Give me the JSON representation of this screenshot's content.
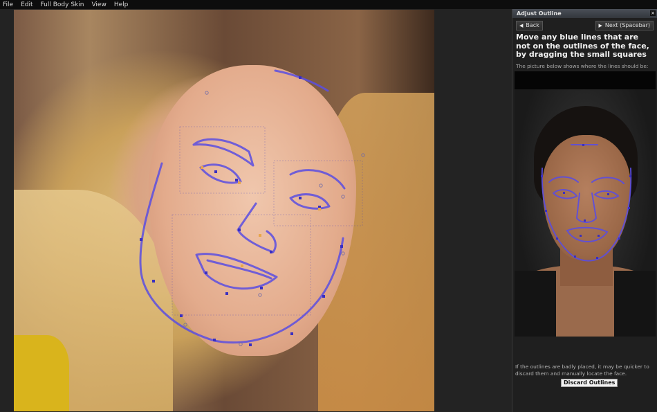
{
  "menu": {
    "items": [
      "File",
      "Edit",
      "Full Body Skin",
      "View",
      "Help"
    ]
  },
  "panel": {
    "title": "Adjust Outline",
    "close_icon": "close-icon",
    "back_label": "Back",
    "next_label": "Next (Spacebar)",
    "heading": "Move any blue lines that are not on the outlines of the face, by dragging the small squares",
    "subtext": "The picture below shows where the lines should be:",
    "footer_text": "If the outlines are badly placed, it may be quicker to discard them and manually locate the face.",
    "discard_label": "Discard Outlines"
  },
  "colors": {
    "outline": "#5a4de0",
    "handle": "#3a2fc0",
    "handle_selected": "#e8a64a"
  },
  "icons": {
    "back": "triangle-left-icon",
    "next": "triangle-right-icon"
  }
}
